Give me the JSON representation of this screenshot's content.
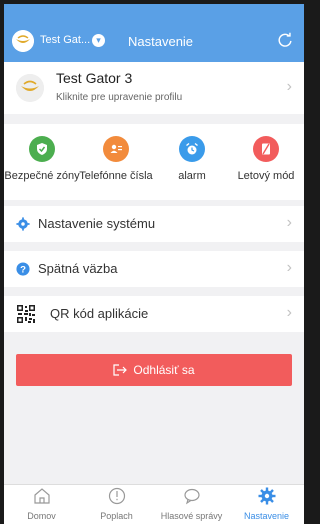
{
  "header": {
    "user_name": "Test Gat...",
    "title": "Nastavenie"
  },
  "profile": {
    "name": "Test Gator 3",
    "subtitle": "Kliknite pre upravenie profilu"
  },
  "features": [
    {
      "label": "Bezpečné zóny",
      "icon": "shield-check-icon",
      "color": "#4cae4f"
    },
    {
      "label": "Telefónne čísla",
      "icon": "contact-card-icon",
      "color": "#f28b3c"
    },
    {
      "label": "alarm",
      "icon": "alarm-clock-icon",
      "color": "#3a9bea"
    },
    {
      "label": "Letový mód",
      "icon": "airplane-mode-off-icon",
      "color": "#f25c5c"
    }
  ],
  "menu": {
    "system_settings": "Nastavenie systému",
    "feedback": "Spätná väzba",
    "qr_code": "QR kód aplikácie"
  },
  "logout_label": "Odhlásiť sa",
  "bottom_nav": [
    {
      "label": "Domov",
      "icon": "home-icon"
    },
    {
      "label": "Poplach",
      "icon": "alert-icon"
    },
    {
      "label": "Hlasové správy",
      "icon": "chat-bubble-icon"
    },
    {
      "label": "Nastavenie",
      "icon": "settings-gear-icon",
      "active": true
    }
  ],
  "colors": {
    "accent": "#5aa0e6",
    "logout": "#f25c5c",
    "active_tab": "#3a8ee6"
  }
}
